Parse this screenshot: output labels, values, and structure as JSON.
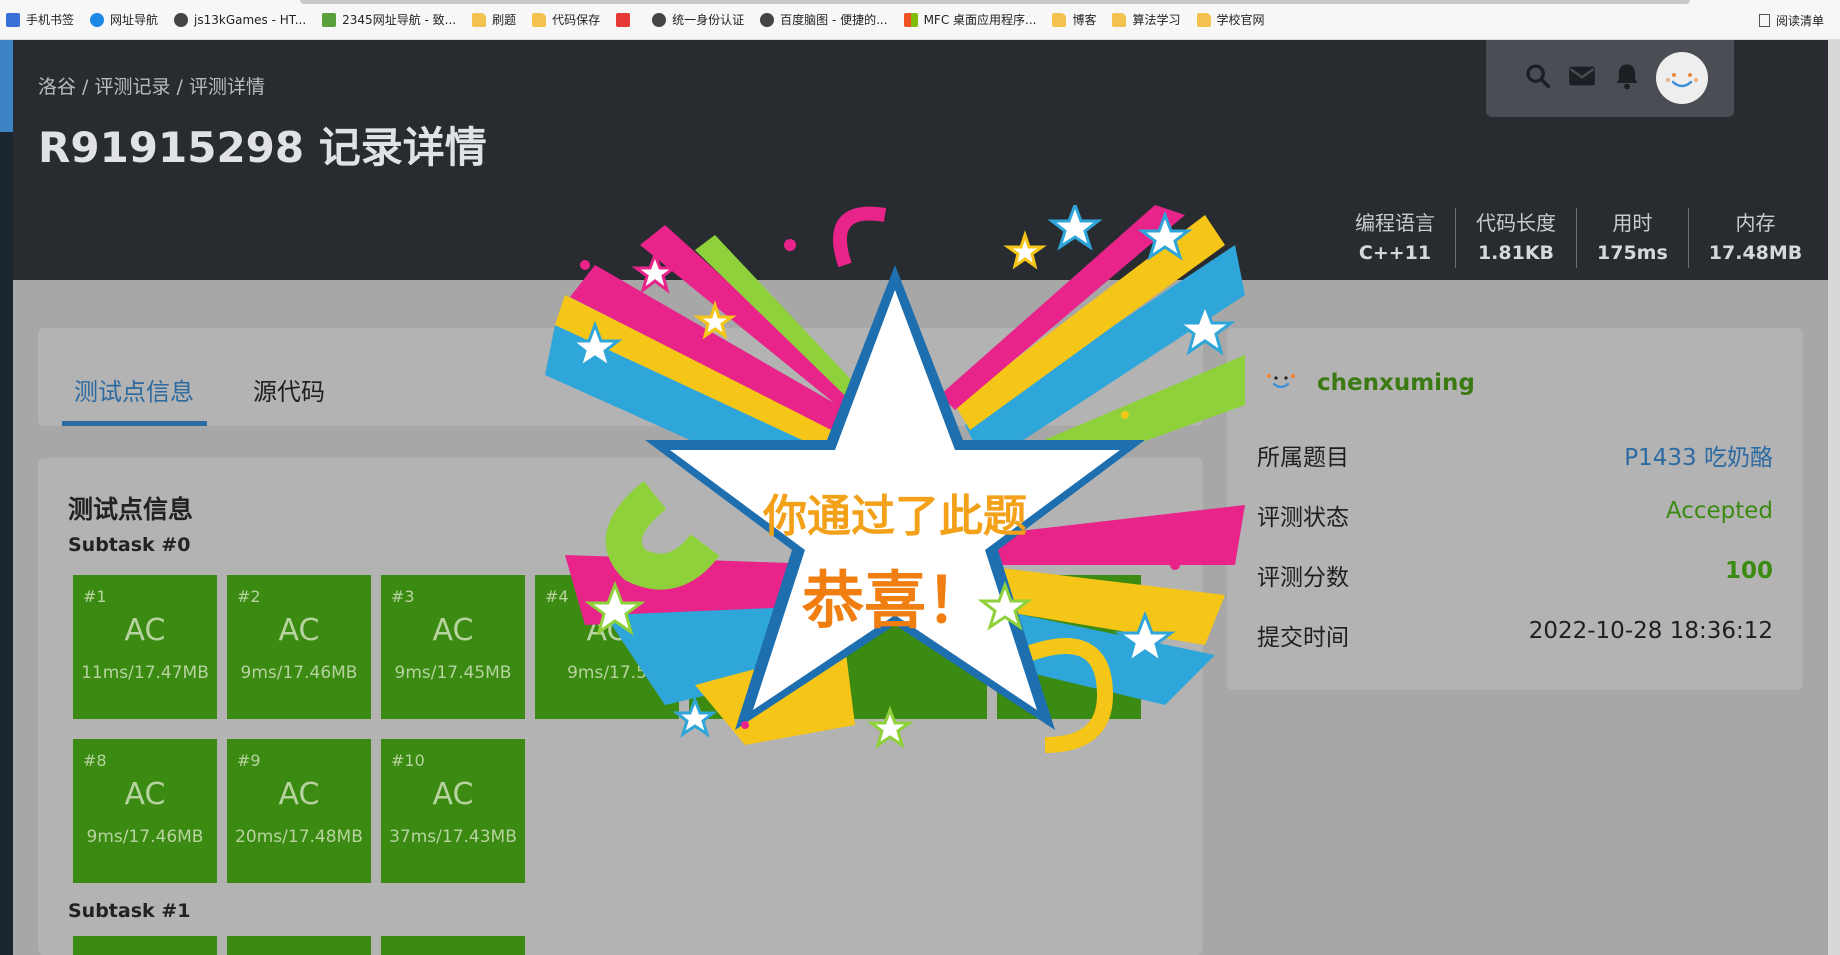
{
  "bookmarks": [
    {
      "icon": "phone-icon",
      "label": "手机书签"
    },
    {
      "icon": "edge-icon",
      "label": "网址导航"
    },
    {
      "icon": "edge-icon",
      "label": "js13kGames - HT..."
    },
    {
      "icon": "house-icon",
      "label": "2345网址导航 - 致..."
    },
    {
      "icon": "folder-icon",
      "label": "刷题"
    },
    {
      "icon": "folder-icon",
      "label": "代码保存"
    },
    {
      "icon": "c-icon",
      "label": ""
    },
    {
      "icon": "edge-icon",
      "label": "统一身份认证"
    },
    {
      "icon": "panda-icon",
      "label": "百度脑图 - 便捷的..."
    },
    {
      "icon": "microsoft-icon",
      "label": "MFC 桌面应用程序..."
    },
    {
      "icon": "folder-icon",
      "label": "博客"
    },
    {
      "icon": "folder-icon",
      "label": "算法学习"
    },
    {
      "icon": "folder-icon",
      "label": "学校官网"
    }
  ],
  "reading_list": "阅读清单",
  "breadcrumb": [
    "洛谷",
    "评测记录",
    "评测详情"
  ],
  "breadcrumb_sep": " / ",
  "title": "R91915298 记录详情",
  "meta": [
    {
      "label": "编程语言",
      "value": "C++11"
    },
    {
      "label": "代码长度",
      "value": "1.81KB"
    },
    {
      "label": "用时",
      "value": "175ms"
    },
    {
      "label": "内存",
      "value": "17.48MB"
    }
  ],
  "tabs": {
    "tests": "测试点信息",
    "source": "源代码"
  },
  "tests_heading": "测试点信息",
  "subtasks": [
    {
      "name": "Subtask #0",
      "cases": [
        {
          "no": "#1",
          "status": "AC",
          "info": "11ms/17.47MB"
        },
        {
          "no": "#2",
          "status": "AC",
          "info": "9ms/17.46MB"
        },
        {
          "no": "#3",
          "status": "AC",
          "info": "9ms/17.45MB"
        },
        {
          "no": "#4",
          "status": "AC",
          "info": "9ms/17.5"
        },
        {
          "no": "#8",
          "status": "AC",
          "info": "9ms/17.46MB"
        },
        {
          "no": "#9",
          "status": "AC",
          "info": "20ms/17.48MB"
        },
        {
          "no": "#10",
          "status": "AC",
          "info": "37ms/17.43MB"
        }
      ]
    },
    {
      "name": "Subtask #1",
      "cases": []
    }
  ],
  "user": {
    "name": "chenxuming"
  },
  "info": [
    {
      "key": "所属题目",
      "value": "P1433 吃奶酪"
    },
    {
      "key": "评测状态",
      "value": "Accepted"
    },
    {
      "key": "评测分数",
      "value": "100"
    },
    {
      "key": "提交时间",
      "value": "2022-10-28 18:36:12"
    }
  ],
  "celebration": {
    "line1": "你通过了此题",
    "line2": "恭喜！"
  }
}
